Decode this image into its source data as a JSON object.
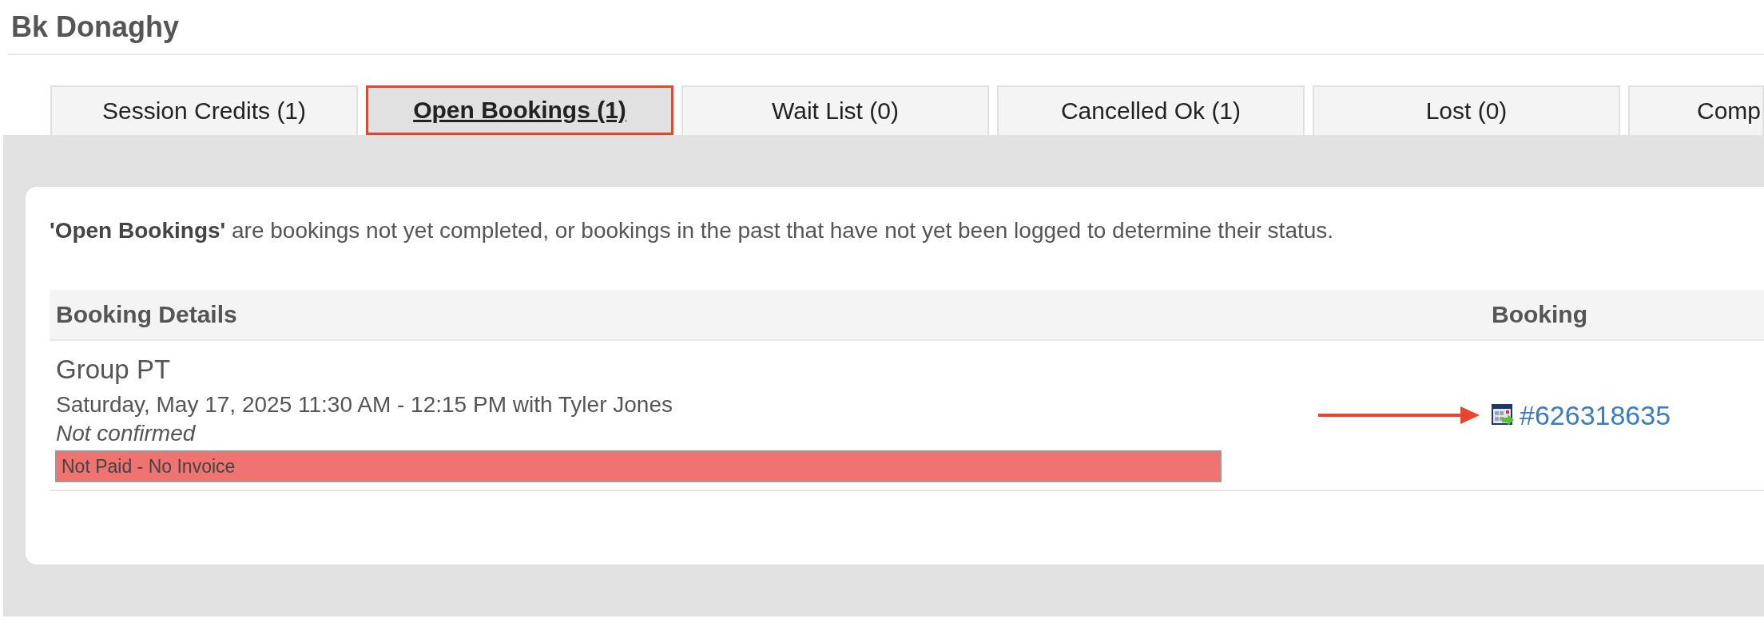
{
  "header": {
    "title": "Bk Donaghy"
  },
  "tabs": [
    {
      "label": "Session Credits (1)",
      "selected": false,
      "highlighted": false
    },
    {
      "label": "Open Bookings (1)",
      "selected": true,
      "highlighted": true
    },
    {
      "label": "Wait List (0)",
      "selected": false,
      "highlighted": false
    },
    {
      "label": "Cancelled Ok (1)",
      "selected": false,
      "highlighted": false
    },
    {
      "label": "Lost (0)",
      "selected": false,
      "highlighted": false
    },
    {
      "label": "Comp",
      "selected": false,
      "highlighted": false
    }
  ],
  "panel": {
    "description": "**'Open Bookings'** are bookings not yet completed, or bookings in the past that have not yet been logged to determine their status.",
    "table": {
      "columns": [
        "Booking Details",
        "Booking"
      ],
      "rows": [
        {
          "session": "Group PT",
          "schedule": "Saturday, May 17, 2025 11:30 AM - 12:15 PM with Tyler Jones",
          "confirmation": "Not confirmed",
          "payment": {
            "label": "Not Paid - No Invoice",
            "kind": "unpaid"
          },
          "booking": "#626318635",
          "arrow": true
        }
      ]
    }
  }
}
